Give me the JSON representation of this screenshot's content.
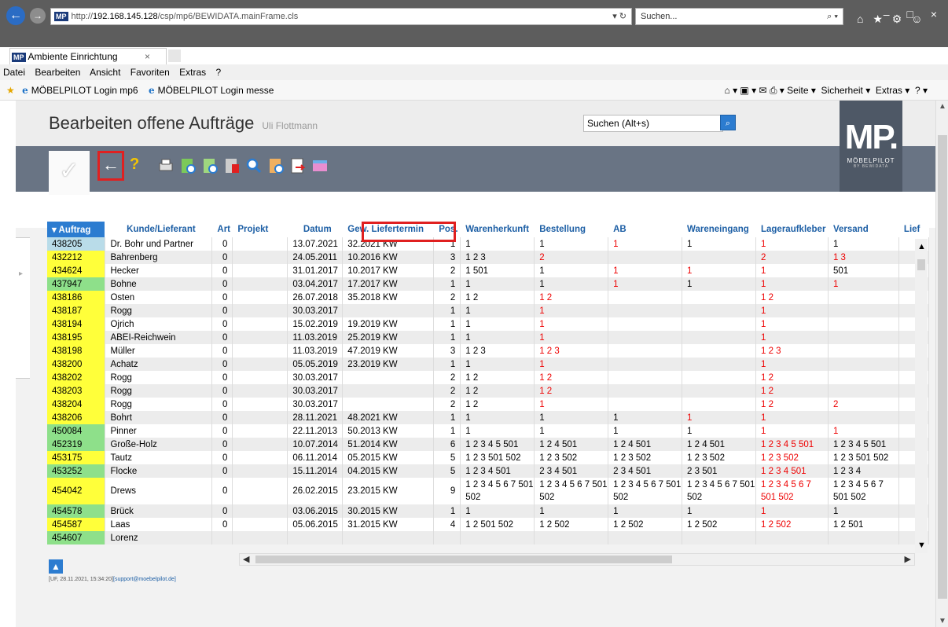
{
  "browser": {
    "url_prefix": "http://",
    "url_host": "192.168.145.128",
    "url_path": "/csp/mp6/BEWIDATA.mainFrame.cls",
    "url_tools": "▾ ↻",
    "search_placeholder": "Suchen...",
    "tab_title": "Ambiente Einrichtung",
    "tab_close": "×",
    "mp_badge": "MP"
  },
  "menu": [
    "Datei",
    "Bearbeiten",
    "Ansicht",
    "Favoriten",
    "Extras",
    "?"
  ],
  "favorites": [
    "MÖBELPILOT Login mp6",
    "MÖBELPILOT Login messe"
  ],
  "commandbar": {
    "page": "Seite ▾",
    "security": "Sicherheit ▾",
    "extras": "Extras ▾"
  },
  "app": {
    "title": "Bearbeiten offene Aufträge",
    "user": "Uli Flottmann",
    "search_placeholder": "Suchen (Alt+s)",
    "logo_big": "MP.",
    "logo_small": "MÖBELPILOT",
    "logo_tiny": "BY BEWIDATA"
  },
  "grid": {
    "columns": [
      "▾ Auftrag",
      "Kunde/Lieferant",
      "Art",
      "Projekt",
      "Datum",
      "Gew. Liefertermin",
      "Pos.",
      "Warenherkunft",
      "Bestellung",
      "AB",
      "Wareneingang",
      "Lageraufkleber",
      "Versand",
      "Lief"
    ],
    "rows": [
      {
        "auftrag": "438205",
        "kunde": "Dr. Bohr und Partner",
        "art": "0",
        "projekt": "",
        "datum": "13.07.2021",
        "liefer": "32.2021 KW",
        "pos": "1",
        "herkunft": "1",
        "bestellung": "1",
        "ab": "1",
        "eingang": "1",
        "lager": "1",
        "versand": "1"
      },
      {
        "auftrag": "432212",
        "kunde": "Bahrenberg",
        "art": "0",
        "projekt": "",
        "datum": "24.05.2011",
        "liefer": "10.2016 KW",
        "pos": "3",
        "herkunft": "1 2 3",
        "bestellung": "2",
        "ab": "",
        "eingang": "",
        "lager": "2",
        "versand": "1 3"
      },
      {
        "auftrag": "434624",
        "kunde": "Hecker",
        "art": "0",
        "projekt": "",
        "datum": "31.01.2017",
        "liefer": "10.2017 KW",
        "pos": "2",
        "herkunft": "1 501",
        "bestellung": "1",
        "ab": "1",
        "eingang": "1",
        "lager": "1",
        "versand": "501"
      },
      {
        "auftrag": "437947",
        "kunde": "Bohne",
        "art": "0",
        "projekt": "",
        "datum": "03.04.2017",
        "liefer": "17.2017 KW",
        "pos": "1",
        "herkunft": "1",
        "bestellung": "1",
        "ab": "1",
        "eingang": "1",
        "lager": "1",
        "versand": "1"
      },
      {
        "auftrag": "438186",
        "kunde": "Osten",
        "art": "0",
        "projekt": "",
        "datum": "26.07.2018",
        "liefer": "35.2018 KW",
        "pos": "2",
        "herkunft": "1 2",
        "bestellung": "1 2",
        "ab": "",
        "eingang": "",
        "lager": "1 2",
        "versand": ""
      },
      {
        "auftrag": "438187",
        "kunde": "Rogg",
        "art": "0",
        "projekt": "",
        "datum": "30.03.2017",
        "liefer": "",
        "pos": "1",
        "herkunft": "1",
        "bestellung": "1",
        "ab": "",
        "eingang": "",
        "lager": "1",
        "versand": ""
      },
      {
        "auftrag": "438194",
        "kunde": "Ojrich",
        "art": "0",
        "projekt": "",
        "datum": "15.02.2019",
        "liefer": "19.2019 KW",
        "pos": "1",
        "herkunft": "1",
        "bestellung": "1",
        "ab": "",
        "eingang": "",
        "lager": "1",
        "versand": ""
      },
      {
        "auftrag": "438195",
        "kunde": "ABEI-Reichwein",
        "art": "0",
        "projekt": "",
        "datum": "11.03.2019",
        "liefer": "25.2019 KW",
        "pos": "1",
        "herkunft": "1",
        "bestellung": "1",
        "ab": "",
        "eingang": "",
        "lager": "1",
        "versand": ""
      },
      {
        "auftrag": "438198",
        "kunde": "Müller",
        "art": "0",
        "projekt": "",
        "datum": "11.03.2019",
        "liefer": "47.2019 KW",
        "pos": "3",
        "herkunft": "1 2 3",
        "bestellung": "1 2 3",
        "ab": "",
        "eingang": "",
        "lager": "1 2 3",
        "versand": ""
      },
      {
        "auftrag": "438200",
        "kunde": "Achatz",
        "art": "0",
        "projekt": "",
        "datum": "05.05.2019",
        "liefer": "23.2019 KW",
        "pos": "1",
        "herkunft": "1",
        "bestellung": "1",
        "ab": "",
        "eingang": "",
        "lager": "1",
        "versand": ""
      },
      {
        "auftrag": "438202",
        "kunde": "Rogg",
        "art": "0",
        "projekt": "",
        "datum": "30.03.2017",
        "liefer": "",
        "pos": "2",
        "herkunft": "1 2",
        "bestellung": "1 2",
        "ab": "",
        "eingang": "",
        "lager": "1 2",
        "versand": ""
      },
      {
        "auftrag": "438203",
        "kunde": "Rogg",
        "art": "0",
        "projekt": "",
        "datum": "30.03.2017",
        "liefer": "",
        "pos": "2",
        "herkunft": "1 2",
        "bestellung": "1 2",
        "ab": "",
        "eingang": "",
        "lager": "1 2",
        "versand": ""
      },
      {
        "auftrag": "438204",
        "kunde": "Rogg",
        "art": "0",
        "projekt": "",
        "datum": "30.03.2017",
        "liefer": "",
        "pos": "2",
        "herkunft": "1 2",
        "bestellung": "1",
        "ab": "",
        "eingang": "",
        "lager": "1 2",
        "versand": "2"
      },
      {
        "auftrag": "438206",
        "kunde": "Bohrt",
        "art": "0",
        "projekt": "",
        "datum": "28.11.2021",
        "liefer": "48.2021 KW",
        "pos": "1",
        "herkunft": "1",
        "bestellung": "1",
        "ab": "1",
        "eingang": "1",
        "lager": "1",
        "versand": ""
      },
      {
        "auftrag": "450084",
        "kunde": "Pinner",
        "art": "0",
        "projekt": "",
        "datum": "22.11.2013",
        "liefer": "50.2013 KW",
        "pos": "1",
        "herkunft": "1",
        "bestellung": "1",
        "ab": "1",
        "eingang": "1",
        "lager": "1",
        "versand": "1"
      },
      {
        "auftrag": "452319",
        "kunde": "Große-Holz",
        "art": "0",
        "projekt": "",
        "datum": "10.07.2014",
        "liefer": "51.2014 KW",
        "pos": "6",
        "herkunft": "1 2 3 4 5 501",
        "bestellung": "1 2 4 501",
        "ab": "1 2 4 501",
        "eingang": "1 2 4 501",
        "lager": "1 2 3 4 5 501",
        "versand": "1 2 3 4 5 501"
      },
      {
        "auftrag": "453175",
        "kunde": "Tautz",
        "art": "0",
        "projekt": "",
        "datum": "06.11.2014",
        "liefer": "05.2015 KW",
        "pos": "5",
        "herkunft": "1 2 3 501 502",
        "bestellung": "1 2 3 502",
        "ab": "1 2 3 502",
        "eingang": "1 2 3 502",
        "lager": "1 2 3 502",
        "versand": "1 2 3 501 502"
      },
      {
        "auftrag": "453252",
        "kunde": "Flocke",
        "art": "0",
        "projekt": "",
        "datum": "15.11.2014",
        "liefer": "04.2015 KW",
        "pos": "5",
        "herkunft": "1 2 3 4 501",
        "bestellung": "2 3 4 501",
        "ab": "2 3 4 501",
        "eingang": "2 3 501",
        "lager": "1 2 3 4 501",
        "versand": "1 2 3 4"
      },
      {
        "auftrag": "454042",
        "kunde": "Drews",
        "art": "0",
        "projekt": "",
        "datum": "26.02.2015",
        "liefer": "23.2015 KW",
        "pos": "9",
        "herkunft": "1 2 3 4 5 6 7 501 502",
        "bestellung": "1 2 3 4 5 6 7 501 502",
        "ab": "1 2 3 4 5 6 7 501 502",
        "eingang": "1 2 3 4 5 6 7 501 502",
        "lager": "1 2 3 4 5 6 7 501 502",
        "versand": "1 2 3 4 5 6 7 501 502"
      },
      {
        "auftrag": "454578",
        "kunde": "Brück",
        "art": "0",
        "projekt": "",
        "datum": "03.06.2015",
        "liefer": "30.2015 KW",
        "pos": "1",
        "herkunft": "1",
        "bestellung": "1",
        "ab": "1",
        "eingang": "1",
        "lager": "1",
        "versand": "1"
      },
      {
        "auftrag": "454587",
        "kunde": "Laas",
        "art": "0",
        "projekt": "",
        "datum": "05.06.2015",
        "liefer": "31.2015 KW",
        "pos": "4",
        "herkunft": "1 2 501 502",
        "bestellung": "1 2 502",
        "ab": "1 2 502",
        "eingang": "1 2 502",
        "lager": "1 2 502",
        "versand": "1 2 501"
      },
      {
        "auftrag": "454607",
        "kunde": "Lorenz",
        "art": "",
        "projekt": "",
        "datum": "",
        "liefer": "",
        "pos": "",
        "herkunft": "",
        "bestellung": "",
        "ab": "",
        "eingang": "",
        "lager": "",
        "versand": ""
      }
    ]
  },
  "footer": {
    "stamp": "[UF, 28.11.2021, 15:34:20]",
    "email": "[support@moebelpilot.de]"
  },
  "colors": {
    "header_band": "#697484",
    "sorted_header": "#2c7cd0",
    "highlight_red": "#e02020",
    "yellow_cell": "#ffff3a",
    "green_cell": "#8ee08a"
  }
}
